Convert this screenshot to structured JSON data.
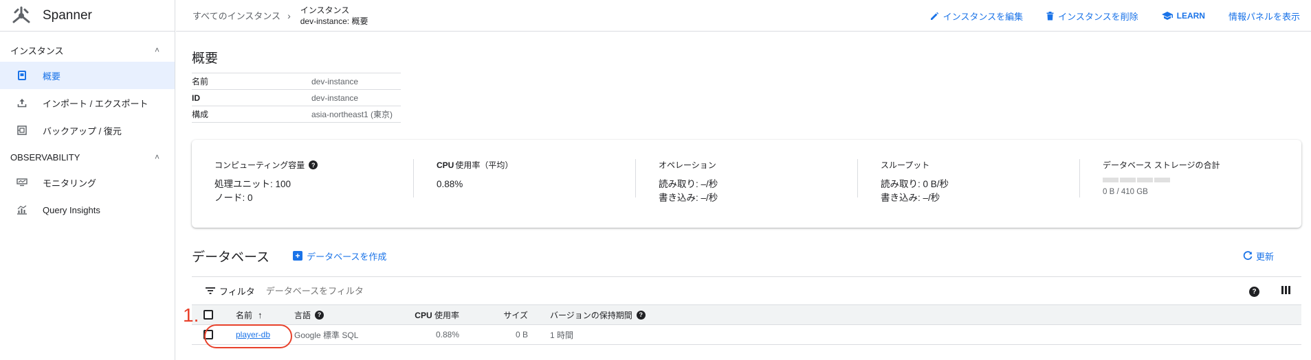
{
  "app": {
    "title": "Spanner"
  },
  "sidebar": {
    "sections": [
      {
        "label": "インスタンス",
        "items": [
          {
            "label": "概要",
            "icon": "overview-icon",
            "active": true
          },
          {
            "label": "インポート / エクスポート",
            "icon": "upload-icon"
          },
          {
            "label": "バックアップ / 復元",
            "icon": "backup-icon"
          }
        ]
      },
      {
        "label": "OBSERVABILITY",
        "items": [
          {
            "label": "モニタリング",
            "icon": "monitoring-icon"
          },
          {
            "label": "Query Insights",
            "icon": "insights-icon"
          }
        ]
      }
    ]
  },
  "breadcrumb": {
    "root": "すべてのインスタンス",
    "current_type": "インスタンス",
    "current_name": "dev-instance: 概要"
  },
  "actions": {
    "edit": "インスタンスを編集",
    "delete": "インスタンスを削除",
    "learn": "LEARN",
    "info_panel": "情報パネルを表示"
  },
  "overview": {
    "title": "概要",
    "rows": [
      {
        "key": "名前",
        "value": "dev-instance"
      },
      {
        "key": "ID",
        "value": "dev-instance"
      },
      {
        "key": "構成",
        "value": "asia-northeast1 (東京)"
      }
    ]
  },
  "metrics": {
    "compute": {
      "title": "コンピューティング容量",
      "line1": "処理ユニット: 100",
      "line2": "ノード: 0"
    },
    "cpu": {
      "title_bold": "CPU",
      "title_rest": "使用率（平均）",
      "value": "0.88%"
    },
    "operations": {
      "title": "オペレーション",
      "line1": "読み取り: –/秒",
      "line2": "書き込み: –/秒"
    },
    "throughput": {
      "title": "スループット",
      "line1": "読み取り: 0 B/秒",
      "line2": "書き込み: –/秒"
    },
    "storage": {
      "title": "データベース ストレージの合計",
      "value": "0 B / 410 GB",
      "used_fraction": 0
    }
  },
  "databases": {
    "title": "データベース",
    "create_label": "データベースを作成",
    "refresh_label": "更新",
    "filter_label": "フィルタ",
    "filter_placeholder": "データベースをフィルタ",
    "columns": {
      "name": "名前",
      "language": "言語",
      "cpu_bold": "CPU",
      "cpu_rest": "使用率",
      "size": "サイズ",
      "retention": "バージョンの保持期間"
    },
    "rows": [
      {
        "name": "player-db",
        "language": "Google 標準 SQL",
        "cpu": "0.88%",
        "size": "0 B",
        "retention": "1 時間"
      }
    ]
  },
  "annotation": {
    "label": "1."
  },
  "colors": {
    "accent": "#1a73e8",
    "annotation": "#e8402a"
  }
}
